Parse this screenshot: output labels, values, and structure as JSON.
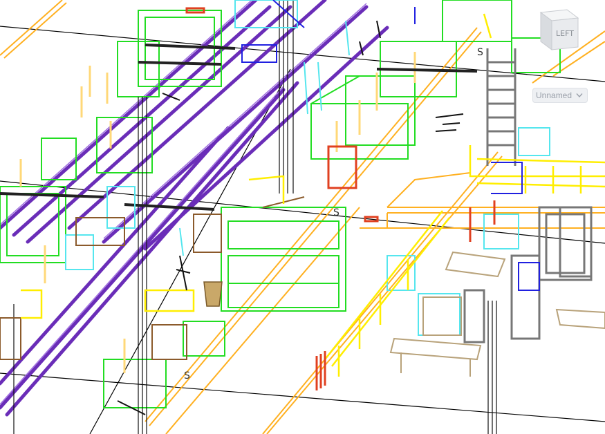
{
  "viewcube": {
    "face_label": "LEFT",
    "icon": "viewcube-icon"
  },
  "view_selector": {
    "value": "Unnamed",
    "icon": "chevron-down-icon"
  },
  "scene": {
    "description_colors": {
      "conveyor": "#6f2fbf",
      "racks": "#22dd22",
      "walkway_rail": "#ffee00",
      "floor_line": "#ffb020",
      "equipment_gray": "#808080",
      "cyan": "#55e6ee",
      "brown": "#8b5a2b",
      "tan": "#b8a27a",
      "red": "#e04020",
      "blue": "#2020e0",
      "black": "#111111"
    },
    "floor_markers": [
      "S",
      "S",
      "S"
    ]
  }
}
